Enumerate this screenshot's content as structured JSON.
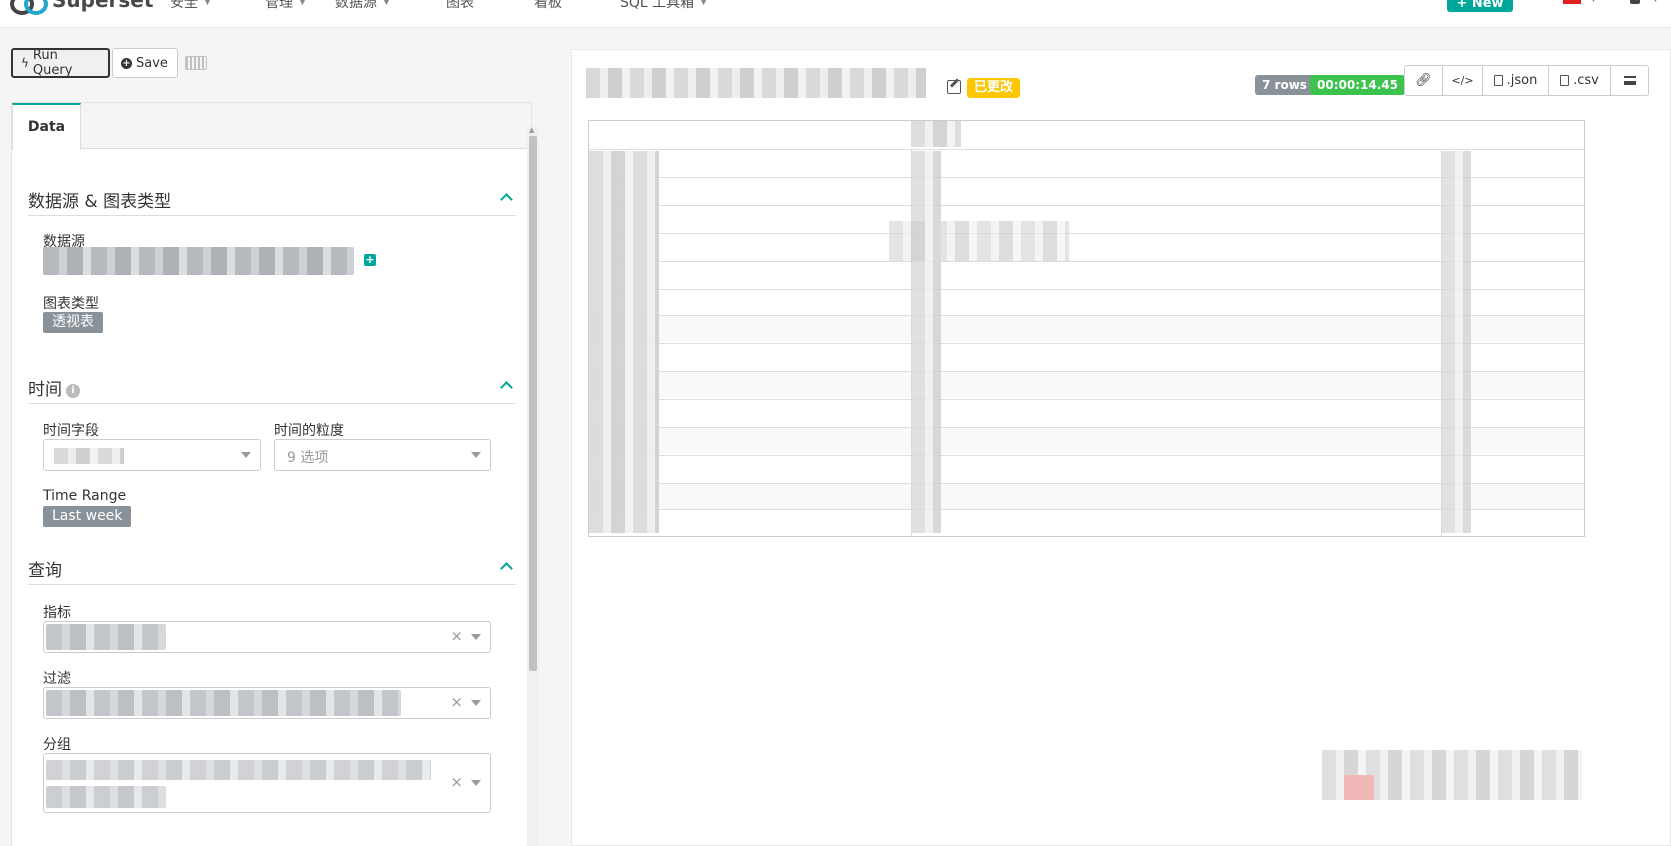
{
  "nav": {
    "brand": "Superset",
    "items": [
      {
        "label": "安全",
        "icon": "lock-icon"
      },
      {
        "label": "管理",
        "icon": ""
      },
      {
        "label": "数据源",
        "icon": "database-icon"
      },
      {
        "label": "图表",
        "icon": "chart-icon"
      },
      {
        "label": "看板",
        "icon": "dashboard-icon"
      },
      {
        "label": "SQL 工具箱",
        "icon": "flask-icon"
      }
    ],
    "new_button": "+ New"
  },
  "toolbar": {
    "run_query": "Run Query",
    "save": "Save"
  },
  "tabs": {
    "data": "Data"
  },
  "sections": {
    "datasource": {
      "title": "数据源 & 图表类型",
      "datasource_label": "数据源",
      "viz_label": "图表类型",
      "viz_value": "透视表"
    },
    "time": {
      "title": "时间",
      "time_column_label": "时间字段",
      "time_grain_label": "时间的粒度",
      "time_grain_placeholder": "9 选项",
      "time_range_label": "Time Range",
      "time_range_value": "Last week"
    },
    "query": {
      "title": "查询",
      "metrics_label": "指标",
      "filters_label": "过滤",
      "groupby_label": "分组"
    }
  },
  "result": {
    "modified_badge": "已更改",
    "rows_badge": "7 rows",
    "duration_badge": "00:00:14.45",
    "json_label": ".json",
    "csv_label": ".csv"
  }
}
